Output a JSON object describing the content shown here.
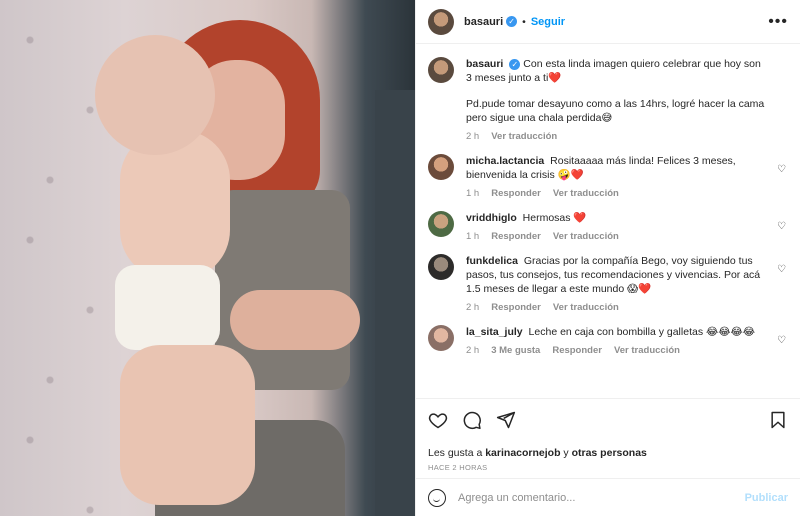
{
  "post": {
    "author": "basauri",
    "follow_label": "Seguir",
    "dot": "•",
    "more": "•••"
  },
  "caption": {
    "user": "basauri",
    "line1": "Con esta linda imagen quiero celebrar que hoy son 3 meses junto a ti❤️",
    "line2": "Pd.pude tomar desayuno como a las 14hrs, logré hacer la cama pero sigue una chala perdida😅",
    "time": "2 h",
    "translate": "Ver traducción"
  },
  "comments": [
    {
      "user": "micha.lactancia",
      "text": "Rositaaaaa más linda! Felices 3 meses, bienvenida la crisis 🤪❤️",
      "time": "1 h",
      "reply": "Responder",
      "translate": "Ver traducción"
    },
    {
      "user": "vriddhiglo",
      "text": "Hermosas ❤️",
      "time": "1 h",
      "reply": "Responder",
      "translate": "Ver traducción"
    },
    {
      "user": "funkdelica",
      "text": "Gracias por la compañía Bego, voy siguiendo tus pasos, tus consejos, tus recomendaciones y vivencias. Por acá 1.5 meses de llegar a este mundo 😱❤️",
      "time": "2 h",
      "reply": "Responder",
      "translate": "Ver traducción"
    },
    {
      "user": "la_sita_july",
      "text": "Leche en caja con bombilla y galletas 😂😂😂😂",
      "time": "2 h",
      "likes": "3 Me gusta",
      "reply": "Responder",
      "translate": "Ver traducción"
    }
  ],
  "likes": {
    "prefix": "Les gusta a",
    "user": "karinacornejob",
    "connector": "y",
    "others": "otras personas",
    "time": "HACE 2 HORAS"
  },
  "add_comment": {
    "placeholder": "Agrega un comentario...",
    "publish": "Publicar"
  },
  "icons": {
    "like": "heart-icon",
    "comment": "comment-icon",
    "share": "paper-plane-icon",
    "save": "bookmark-icon",
    "emoji": "emoji-icon",
    "verified": "verified-badge-icon"
  }
}
